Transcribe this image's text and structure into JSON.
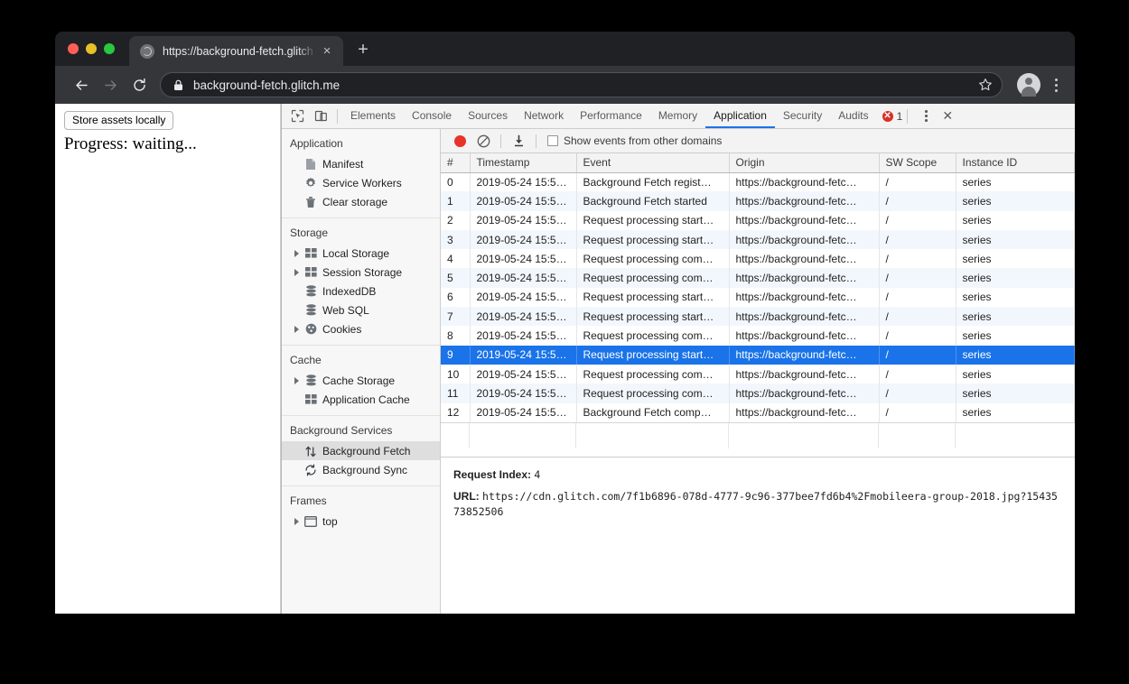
{
  "browser": {
    "tab": {
      "title": "https://background-fetch.glitch",
      "favicon": "globe-icon",
      "close": "×"
    },
    "new_tab": "+",
    "nav": {
      "back": "←",
      "forward": "→",
      "reload": "⟳"
    },
    "omnibox": {
      "url": "background-fetch.glitch.me",
      "lock": "lock-icon",
      "star": "star-icon"
    }
  },
  "page": {
    "store_assets_button": "Store assets locally",
    "progress_text": "Progress: waiting..."
  },
  "devtools": {
    "tabs": [
      {
        "label": "Elements",
        "active": false
      },
      {
        "label": "Console",
        "active": false
      },
      {
        "label": "Sources",
        "active": false
      },
      {
        "label": "Network",
        "active": false
      },
      {
        "label": "Performance",
        "active": false
      },
      {
        "label": "Memory",
        "active": false
      },
      {
        "label": "Application",
        "active": true
      },
      {
        "label": "Security",
        "active": false
      },
      {
        "label": "Audits",
        "active": false
      }
    ],
    "error_count": "1",
    "error_badge_glyph": "✕",
    "close_label": "✕",
    "accent_color": "#1a73e8",
    "error_color": "#d93025"
  },
  "sidebar": {
    "groups": [
      {
        "title": "Application",
        "items": [
          {
            "label": "Manifest",
            "icon": "document-icon",
            "twisty": false,
            "selected": false
          },
          {
            "label": "Service Workers",
            "icon": "gear-icon",
            "twisty": false,
            "selected": false
          },
          {
            "label": "Clear storage",
            "icon": "trash-icon",
            "twisty": false,
            "selected": false
          }
        ]
      },
      {
        "title": "Storage",
        "items": [
          {
            "label": "Local Storage",
            "icon": "table-icon",
            "twisty": true,
            "selected": false
          },
          {
            "label": "Session Storage",
            "icon": "table-icon",
            "twisty": true,
            "selected": false
          },
          {
            "label": "IndexedDB",
            "icon": "database-icon",
            "twisty": false,
            "selected": false
          },
          {
            "label": "Web SQL",
            "icon": "database-icon",
            "twisty": false,
            "selected": false
          },
          {
            "label": "Cookies",
            "icon": "cookie-icon",
            "twisty": true,
            "selected": false
          }
        ]
      },
      {
        "title": "Cache",
        "items": [
          {
            "label": "Cache Storage",
            "icon": "database-icon",
            "twisty": true,
            "selected": false
          },
          {
            "label": "Application Cache",
            "icon": "table-icon",
            "twisty": false,
            "selected": false
          }
        ]
      },
      {
        "title": "Background Services",
        "items": [
          {
            "label": "Background Fetch",
            "icon": "updown-arrows-icon",
            "twisty": false,
            "selected": true
          },
          {
            "label": "Background Sync",
            "icon": "refresh-icon",
            "twisty": false,
            "selected": false
          }
        ]
      },
      {
        "title": "Frames",
        "items": [
          {
            "label": "top",
            "icon": "frame-icon",
            "twisty": true,
            "selected": false
          }
        ]
      }
    ]
  },
  "toolbar": {
    "record_button": "record-icon",
    "clear_button": "clear-icon",
    "download_button": "download-icon",
    "show_events_label": "Show events from other domains",
    "show_events_checked": false
  },
  "table": {
    "columns": [
      "#",
      "Timestamp",
      "Event",
      "Origin",
      "SW Scope",
      "Instance ID"
    ],
    "rows": [
      {
        "idx": "0",
        "ts": "2019-05-24 15:5…",
        "event": "Background Fetch regist…",
        "origin": "https://background-fetc…",
        "sw": "/",
        "iid": "series",
        "selected": false
      },
      {
        "idx": "1",
        "ts": "2019-05-24 15:5…",
        "event": "Background Fetch started",
        "origin": "https://background-fetc…",
        "sw": "/",
        "iid": "series",
        "selected": false
      },
      {
        "idx": "2",
        "ts": "2019-05-24 15:5…",
        "event": "Request processing start…",
        "origin": "https://background-fetc…",
        "sw": "/",
        "iid": "series",
        "selected": false
      },
      {
        "idx": "3",
        "ts": "2019-05-24 15:5…",
        "event": "Request processing start…",
        "origin": "https://background-fetc…",
        "sw": "/",
        "iid": "series",
        "selected": false
      },
      {
        "idx": "4",
        "ts": "2019-05-24 15:5…",
        "event": "Request processing com…",
        "origin": "https://background-fetc…",
        "sw": "/",
        "iid": "series",
        "selected": false
      },
      {
        "idx": "5",
        "ts": "2019-05-24 15:5…",
        "event": "Request processing com…",
        "origin": "https://background-fetc…",
        "sw": "/",
        "iid": "series",
        "selected": false
      },
      {
        "idx": "6",
        "ts": "2019-05-24 15:5…",
        "event": "Request processing start…",
        "origin": "https://background-fetc…",
        "sw": "/",
        "iid": "series",
        "selected": false
      },
      {
        "idx": "7",
        "ts": "2019-05-24 15:5…",
        "event": "Request processing start…",
        "origin": "https://background-fetc…",
        "sw": "/",
        "iid": "series",
        "selected": false
      },
      {
        "idx": "8",
        "ts": "2019-05-24 15:5…",
        "event": "Request processing com…",
        "origin": "https://background-fetc…",
        "sw": "/",
        "iid": "series",
        "selected": false
      },
      {
        "idx": "9",
        "ts": "2019-05-24 15:5…",
        "event": "Request processing start…",
        "origin": "https://background-fetc…",
        "sw": "/",
        "iid": "series",
        "selected": true
      },
      {
        "idx": "10",
        "ts": "2019-05-24 15:5…",
        "event": "Request processing com…",
        "origin": "https://background-fetc…",
        "sw": "/",
        "iid": "series",
        "selected": false
      },
      {
        "idx": "11",
        "ts": "2019-05-24 15:5…",
        "event": "Request processing com…",
        "origin": "https://background-fetc…",
        "sw": "/",
        "iid": "series",
        "selected": false
      },
      {
        "idx": "12",
        "ts": "2019-05-24 15:5…",
        "event": "Background Fetch comp…",
        "origin": "https://background-fetc…",
        "sw": "/",
        "iid": "series",
        "selected": false
      }
    ]
  },
  "details": {
    "request_index_key": "Request Index:",
    "request_index_value": "4",
    "url_key": "URL:",
    "url_value": "https://cdn.glitch.com/7f1b6896-078d-4777-9c96-377bee7fd6b4%2Fmobileera-group-2018.jpg?1543573852506"
  }
}
